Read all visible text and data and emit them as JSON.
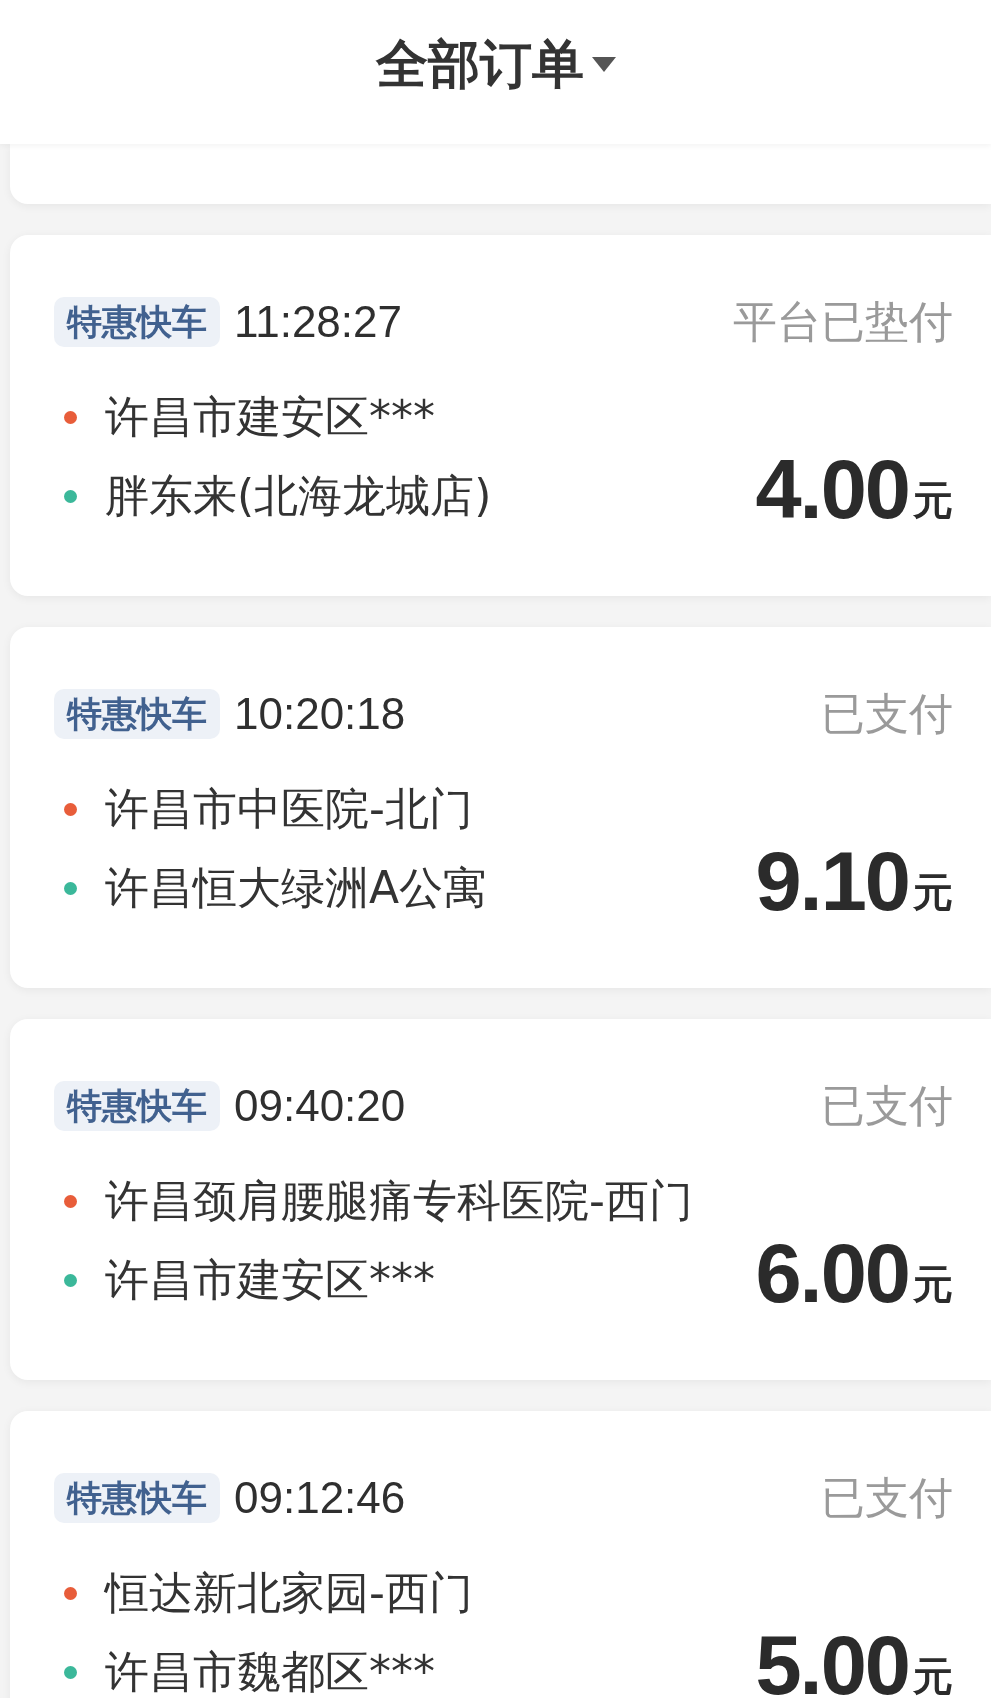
{
  "header": {
    "title": "全部订单"
  },
  "orders": [
    {
      "service": "特惠快车",
      "time": "11:28:27",
      "status": "平台已垫付",
      "stops": [
        {
          "color": "#e85d3a",
          "address": "许昌市建安区***"
        },
        {
          "color": "#3bb89a",
          "address": "胖东来(北海龙城店)"
        }
      ],
      "price": "4.00",
      "currency": "元"
    },
    {
      "service": "特惠快车",
      "time": "10:20:18",
      "status": "已支付",
      "stops": [
        {
          "color": "#e85d3a",
          "address": "许昌市中医院-北门"
        },
        {
          "color": "#3bb89a",
          "address": "许昌恒大绿洲A公寓"
        }
      ],
      "price": "9.10",
      "currency": "元"
    },
    {
      "service": "特惠快车",
      "time": "09:40:20",
      "status": "已支付",
      "stops": [
        {
          "color": "#e85d3a",
          "address": "许昌颈肩腰腿痛专科医院-西门"
        },
        {
          "color": "#3bb89a",
          "address": "许昌市建安区***"
        }
      ],
      "price": "6.00",
      "currency": "元"
    },
    {
      "service": "特惠快车",
      "time": "09:12:46",
      "status": "已支付",
      "stops": [
        {
          "color": "#e85d3a",
          "address": "恒达新北家园-西门"
        },
        {
          "color": "#3bb89a",
          "address": "许昌市魏都区***"
        }
      ],
      "price": "5.00",
      "currency": "元"
    }
  ]
}
